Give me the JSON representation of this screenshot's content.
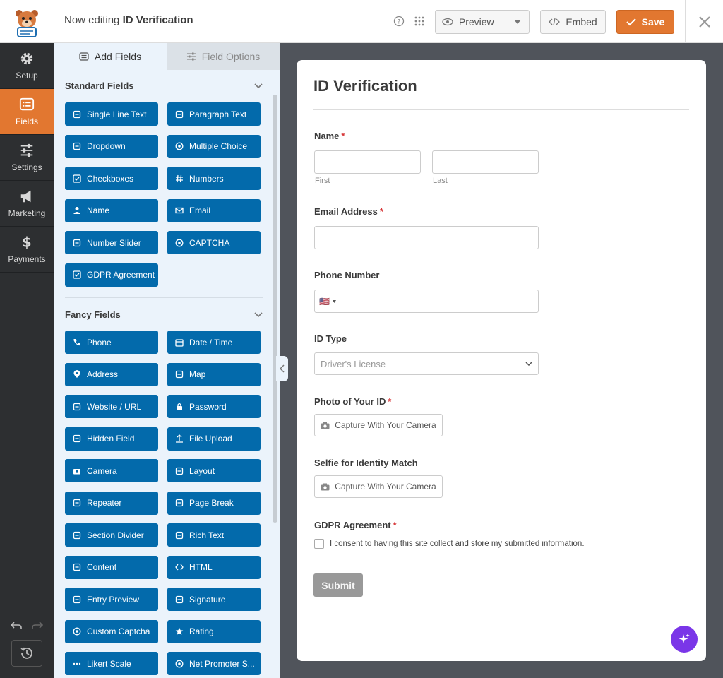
{
  "header": {
    "title_prefix": "Now editing",
    "form_name": "ID Verification",
    "preview_label": "Preview",
    "embed_label": "Embed",
    "save_label": "Save"
  },
  "leftnav": {
    "items": [
      {
        "label": "Setup",
        "icon": "gear-icon"
      },
      {
        "label": "Fields",
        "icon": "fields-icon"
      },
      {
        "label": "Settings",
        "icon": "sliders-icon"
      },
      {
        "label": "Marketing",
        "icon": "megaphone-icon"
      },
      {
        "label": "Payments",
        "icon": "dollar-icon"
      }
    ]
  },
  "panel": {
    "tab_add": "Add Fields",
    "tab_options": "Field Options",
    "standard_title": "Standard Fields",
    "fancy_title": "Fancy Fields",
    "standard_fields": [
      "Single Line Text",
      "Paragraph Text",
      "Dropdown",
      "Multiple Choice",
      "Checkboxes",
      "Numbers",
      "Name",
      "Email",
      "Number Slider",
      "CAPTCHA",
      "GDPR Agreement"
    ],
    "fancy_fields": [
      "Phone",
      "Date / Time",
      "Address",
      "Map",
      "Website / URL",
      "Password",
      "Hidden Field",
      "File Upload",
      "Camera",
      "Layout",
      "Repeater",
      "Page Break",
      "Section Divider",
      "Rich Text",
      "Content",
      "HTML",
      "Entry Preview",
      "Signature",
      "Custom Captcha",
      "Rating",
      "Likert Scale",
      "Net Promoter S..."
    ]
  },
  "form": {
    "title": "ID Verification",
    "name_label": "Name",
    "first_sub": "First",
    "last_sub": "Last",
    "email_label": "Email Address",
    "phone_label": "Phone Number",
    "phone_flag": "🇺🇸",
    "idtype_label": "ID Type",
    "idtype_value": "Driver's License",
    "photo_label": "Photo of Your ID",
    "selfie_label": "Selfie for Identity Match",
    "camera_button": "Capture With Your Camera",
    "gdpr_label": "GDPR Agreement",
    "gdpr_text": "I consent to having this site collect and store my submitted information.",
    "submit_label": "Submit",
    "required_mark": "*"
  },
  "colors": {
    "accent": "#e27730",
    "field_button": "#036aab",
    "sidebar": "#2d2f31",
    "ai_button": "#7a36e8"
  }
}
